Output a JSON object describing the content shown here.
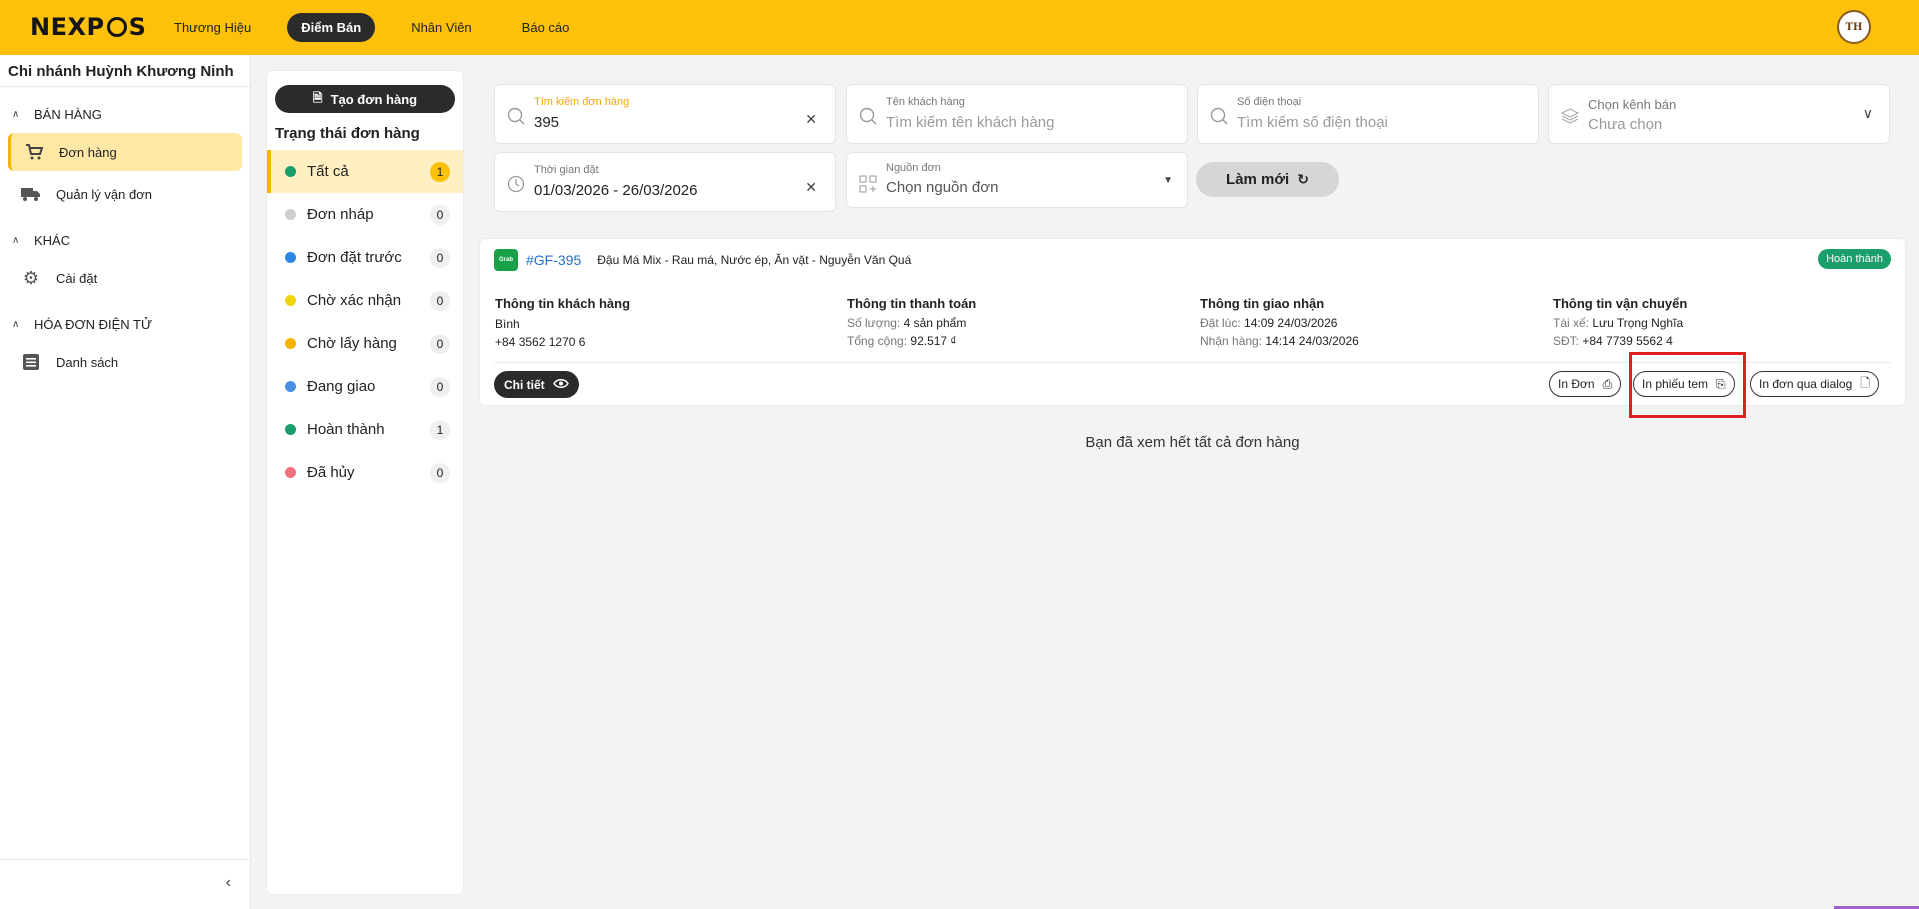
{
  "app": {
    "logo": "NEXPOS",
    "logo_left": "NEXP",
    "logo_right": "S",
    "avatar_initials": "TH",
    "accent_color": "#fdc10c"
  },
  "nav": {
    "items": [
      {
        "label": "Thương Hiệu"
      },
      {
        "label": "Điểm Bán"
      },
      {
        "label": "Nhân Viên"
      },
      {
        "label": "Báo cáo"
      }
    ],
    "active_index": 1
  },
  "sidebar": {
    "branch": "Chi nhánh Huỳnh Khương Ninh",
    "groups": [
      {
        "title": "BÁN HÀNG",
        "items": [
          {
            "label": "Đơn hàng",
            "icon": "cart-icon"
          },
          {
            "label": "Quản lý vận đơn",
            "icon": "truck-icon"
          }
        ]
      },
      {
        "title": "KHÁC",
        "items": [
          {
            "label": "Cài đặt",
            "icon": "gear-icon"
          }
        ]
      },
      {
        "title": "HÓA ĐƠN ĐIỆN TỬ",
        "items": [
          {
            "label": "Danh sách",
            "icon": "list-icon"
          }
        ]
      }
    ]
  },
  "status_panel": {
    "create_label": "Tạo đơn hàng",
    "title": "Trạng thái đơn hàng",
    "statuses": [
      {
        "label": "Tất cả",
        "count": "1",
        "color": "#1a9f6b"
      },
      {
        "label": "Đơn nháp",
        "count": "0",
        "color": "#cfcfcf"
      },
      {
        "label": "Đơn đặt trước",
        "count": "0",
        "color": "#2b87e3"
      },
      {
        "label": "Chờ xác nhận",
        "count": "0",
        "color": "#f2d40c"
      },
      {
        "label": "Chờ lấy hàng",
        "count": "0",
        "color": "#f4b400"
      },
      {
        "label": "Đang giao",
        "count": "0",
        "color": "#4a90e2"
      },
      {
        "label": "Hoàn thành",
        "count": "1",
        "color": "#1a9f6b"
      },
      {
        "label": "Đã hủy",
        "count": "0",
        "color": "#f07080"
      }
    ]
  },
  "filters": {
    "order_search": {
      "label": "Tìm kiếm đơn hàng",
      "value": "395"
    },
    "customer": {
      "label": "Tên khách hàng",
      "placeholder": "Tìm kiếm tên khách hàng"
    },
    "phone": {
      "label": "Số điện thoại",
      "placeholder": "Tìm kiếm số điện thoại"
    },
    "channel": {
      "label": "Chọn kênh bán",
      "value": "Chưa chọn"
    },
    "date": {
      "label": "Thời gian đặt",
      "value": "01/03/2026 - 26/03/2026"
    },
    "source": {
      "label": "Nguồn đơn",
      "placeholder": "Chọn nguồn đơn"
    },
    "refresh_label": "Làm mới"
  },
  "order": {
    "source_badge": "Grab",
    "id": "#GF-395",
    "store": "Đậu Má Mix - Rau má, Nước ép, Ăn vặt - Nguyễn Văn Quá",
    "status": "Hoàn thành",
    "customer": {
      "title": "Thông tin khách hàng",
      "name": "Bình",
      "phone": "+84 3562 1270 6"
    },
    "payment": {
      "title": "Thông tin thanh toán",
      "qty_label": "Số lượng:",
      "qty_value": "4 sản phẩm",
      "total_label": "Tổng cộng:",
      "total_value": "92.517 ₫"
    },
    "delivery": {
      "title": "Thông tin giao nhận",
      "ordered_label": "Đặt lúc:",
      "ordered_value": "14:09 24/03/2026",
      "received_label": "Nhận hàng:",
      "received_value": "14:14 24/03/2026"
    },
    "shipping": {
      "title": "Thông tin vận chuyển",
      "driver_label": "Tài xế:",
      "driver_value": "Lưu Trọng Nghĩa",
      "phone_label": "SĐT:",
      "phone_value": "+84 7739 5562 4"
    },
    "detail_label": "Chi tiết",
    "print_order_label": "In Đơn",
    "print_label_label": "In phiếu tem",
    "print_dialog_label": "In đơn qua dialog"
  },
  "end_message": "Bạn đã xem hết tất cả đơn hàng"
}
